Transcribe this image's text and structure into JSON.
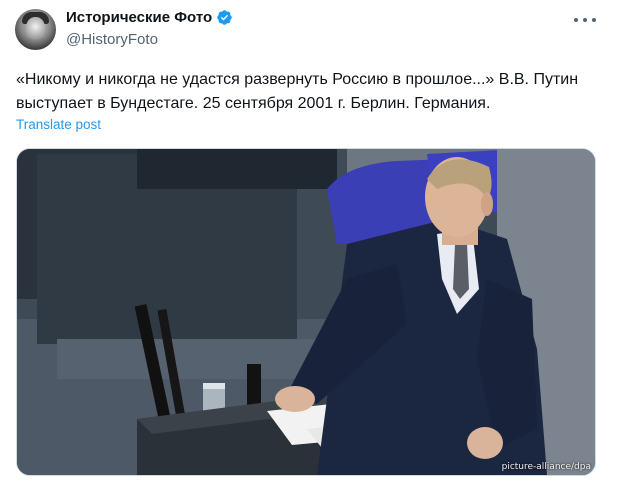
{
  "author": {
    "display_name": "Исторические Фото",
    "handle": "@HistoryFoto",
    "verified_icon": "verified-badge-icon",
    "avatar_icon": "avatar-portrait"
  },
  "menu": {
    "icon": "more-options-icon"
  },
  "post": {
    "text": "«Никому и никогда не удастся развернуть Россию в прошлое...» В.В. Путин выступает в Бундестаге. 25 сентября 2001 г. Берлин. Германия.",
    "translate_label": "Translate post"
  },
  "media": {
    "watermark": "picture-alliance/dpa"
  },
  "colors": {
    "accent": "#1d9bf0",
    "secondary_text": "#536471"
  }
}
